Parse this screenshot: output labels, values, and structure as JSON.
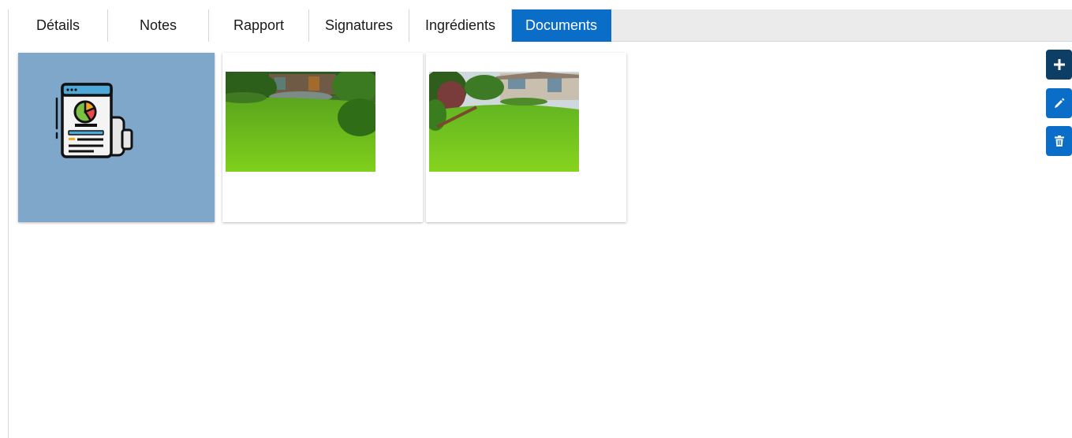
{
  "tabs": [
    {
      "label": "Détails",
      "active": false
    },
    {
      "label": "Notes",
      "active": false
    },
    {
      "label": "Rapport",
      "active": false
    },
    {
      "label": "Signatures",
      "active": false
    },
    {
      "label": "Ingrédients",
      "active": false
    },
    {
      "label": "Documents",
      "active": true
    }
  ],
  "documents": [
    {
      "type": "report",
      "icon": "report-document-icon"
    },
    {
      "type": "image",
      "subject": "garden-lawn-photo"
    },
    {
      "type": "image",
      "subject": "house-lawn-photo"
    }
  ],
  "actions": {
    "add_icon": "plus-icon",
    "edit_icon": "pencil-icon",
    "delete_icon": "trash-icon"
  },
  "colors": {
    "accent": "#0a6ec9",
    "dark_accent": "#0d3f66",
    "doc_card": "#7fa7c9",
    "tabbar_bg": "#ebebeb"
  }
}
